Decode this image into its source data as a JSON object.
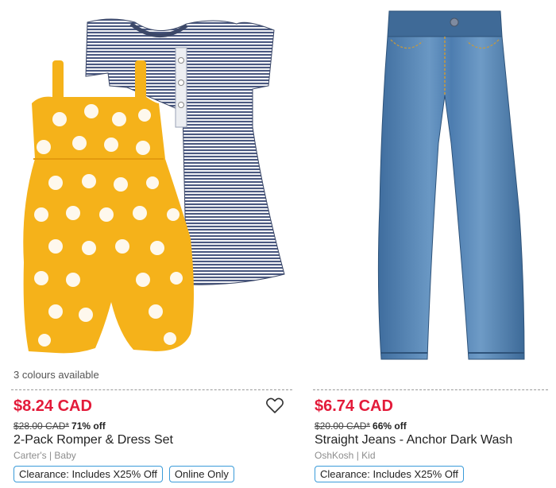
{
  "products": [
    {
      "colours_available": "3 colours available",
      "price": "$8.24 CAD",
      "original_price": "$28.00 CAD*",
      "discount": "71% off",
      "title": "2-Pack Romper & Dress Set",
      "brand": "Carter's | Baby",
      "badges": [
        "Clearance: Includes X25% Off",
        "Online Only"
      ],
      "image": "romper-dress-set-image"
    },
    {
      "price": "$6.74 CAD",
      "original_price": "$20.00 CAD*",
      "discount": "66% off",
      "title": "Straight Jeans - Anchor Dark Wash",
      "brand": "OshKosh | Kid",
      "badges": [
        "Clearance: Includes X25% Off"
      ],
      "image": "straight-jeans-image"
    }
  ],
  "colors": {
    "price_red": "#e31b3a",
    "badge_border": "#3a9bd9",
    "romper_yellow": "#f5b21a",
    "dress_stripe": "#4a5880",
    "denim": "#4f7fb0"
  },
  "icons": {
    "favorite": "heart-outline-icon"
  }
}
